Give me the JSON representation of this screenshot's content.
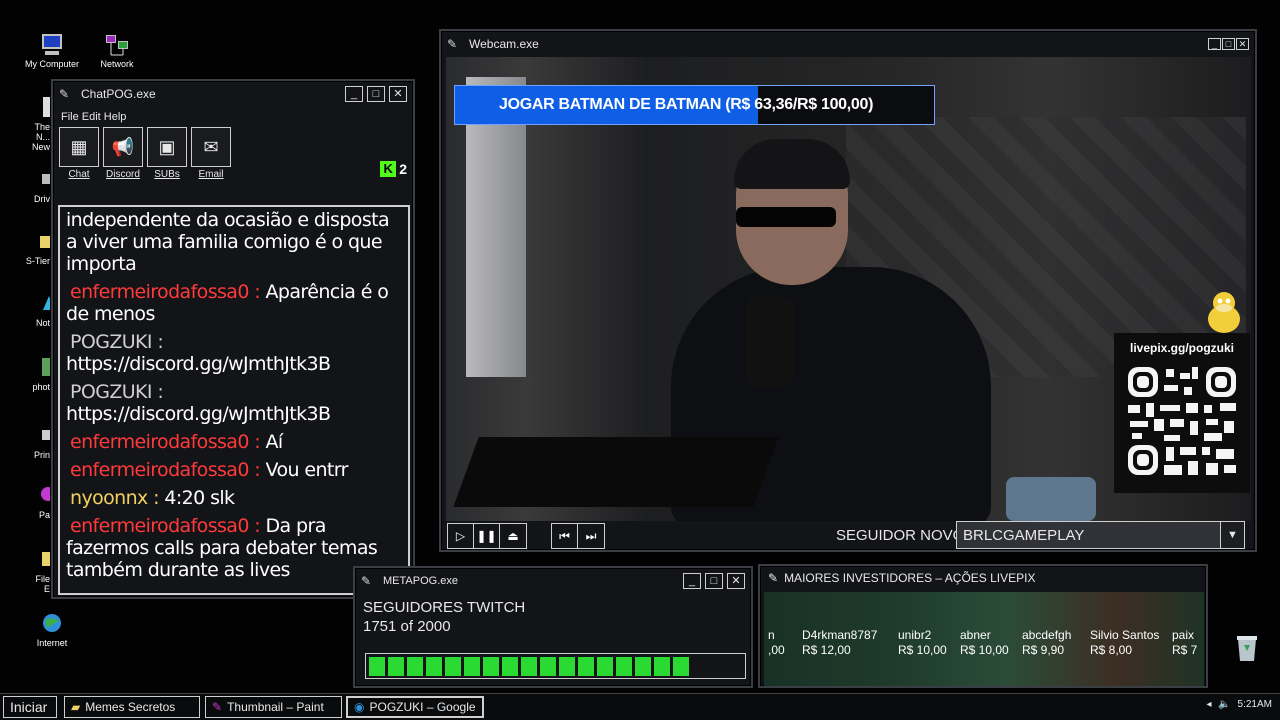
{
  "desktop": {
    "icons": [
      {
        "label": "My Computer",
        "icon": "computer-icon"
      },
      {
        "label": "Network",
        "icon": "network-icon"
      },
      {
        "label": "The N... New",
        "icon": "document-icon"
      },
      {
        "label": "Driv",
        "icon": "drive-icon"
      },
      {
        "label": "S-Tier",
        "icon": "folder-icon"
      },
      {
        "label": "Not",
        "icon": "notepad-icon"
      },
      {
        "label": "phot",
        "icon": "photo-icon"
      },
      {
        "label": "Prin",
        "icon": "printer-icon"
      },
      {
        "label": "Pa",
        "icon": "paint-icon"
      },
      {
        "label": "File E",
        "icon": "folder-icon"
      },
      {
        "label": "Internet",
        "icon": "internet-icon"
      }
    ]
  },
  "chat_window": {
    "title": "ChatPOG.exe",
    "menu": "File Edit Help",
    "tools": [
      {
        "label": "Chat",
        "icon": "chat-icon"
      },
      {
        "label": "Discord",
        "icon": "megaphone-icon"
      },
      {
        "label": "SUBs",
        "icon": "subs-icon"
      },
      {
        "label": "Email",
        "icon": "email-icon"
      }
    ],
    "kick_badge": {
      "letter": "K",
      "count": "2"
    },
    "messages": [
      {
        "user": "",
        "text": "independente da ocasião e disposta a viver uma familia comigo é o que importa",
        "color": "none"
      },
      {
        "user": "enfermeirodafossa0 :",
        "text": "Aparência é o de menos",
        "color": "#ff3a3a"
      },
      {
        "user": "POGZUKI :",
        "text": "https://discord.gg/wJmthJtk3B",
        "color": "#cfcfcf"
      },
      {
        "user": "POGZUKI :",
        "text": "https://discord.gg/wJmthJtk3B",
        "color": "#cfcfcf"
      },
      {
        "user": "enfermeirodafossa0 :",
        "text": "Aí",
        "color": "#ff3a3a"
      },
      {
        "user": "enfermeirodafossa0 :",
        "text": "Vou entrr",
        "color": "#ff3a3a"
      },
      {
        "user": "nyoonnx :",
        "text": "4:20 slk",
        "color": "#f2d25e"
      },
      {
        "user": "enfermeirodafossa0 :",
        "text": "Da pra fazermos calls para debater temas também durante as lives",
        "color": "#ff3a3a"
      }
    ]
  },
  "webcam_window": {
    "title": "Webcam.exe",
    "goal": {
      "text": "JOGAR BATMAN DE BATMAN (R$ 63,36/R$ 100,00)",
      "current": 63.36,
      "target": 100.0,
      "accent": "#0f5fe6"
    },
    "qr": {
      "url": "livepix.gg/pogzuki"
    },
    "follower_label": "SEGUIDOR NOVO",
    "follower_value": "BRLCGAMEPLAY"
  },
  "meta_window": {
    "title": "METAPOG.exe",
    "label": "SEGUIDORES TWITCH",
    "progress_text": "1751 of 2000",
    "current": 1751,
    "goal": 2000,
    "bar_color": "#2ad932"
  },
  "investors_window": {
    "title": "MAIORES INVESTIDORES – AÇÕES LIVEPIX",
    "items": [
      {
        "name": "n",
        "amount": ",00"
      },
      {
        "name": "D4rkman8787",
        "amount": "R$ 12,00"
      },
      {
        "name": "unibr2",
        "amount": "R$ 10,00"
      },
      {
        "name": "abner",
        "amount": "R$ 10,00"
      },
      {
        "name": "abcdefgh",
        "amount": "R$ 9,90"
      },
      {
        "name": "Silvio Santos",
        "amount": "R$ 8,00"
      },
      {
        "name": "paix",
        "amount": "R$ 7"
      }
    ]
  },
  "taskbar": {
    "start": "Iniciar",
    "items": [
      {
        "label": "Memes Secretos",
        "icon": "folder-icon"
      },
      {
        "label": "Thumbnail – Paint",
        "icon": "paint-icon"
      },
      {
        "label": "POGZUKI – Google",
        "icon": "browser-icon"
      }
    ],
    "clock": "5:21AM"
  }
}
